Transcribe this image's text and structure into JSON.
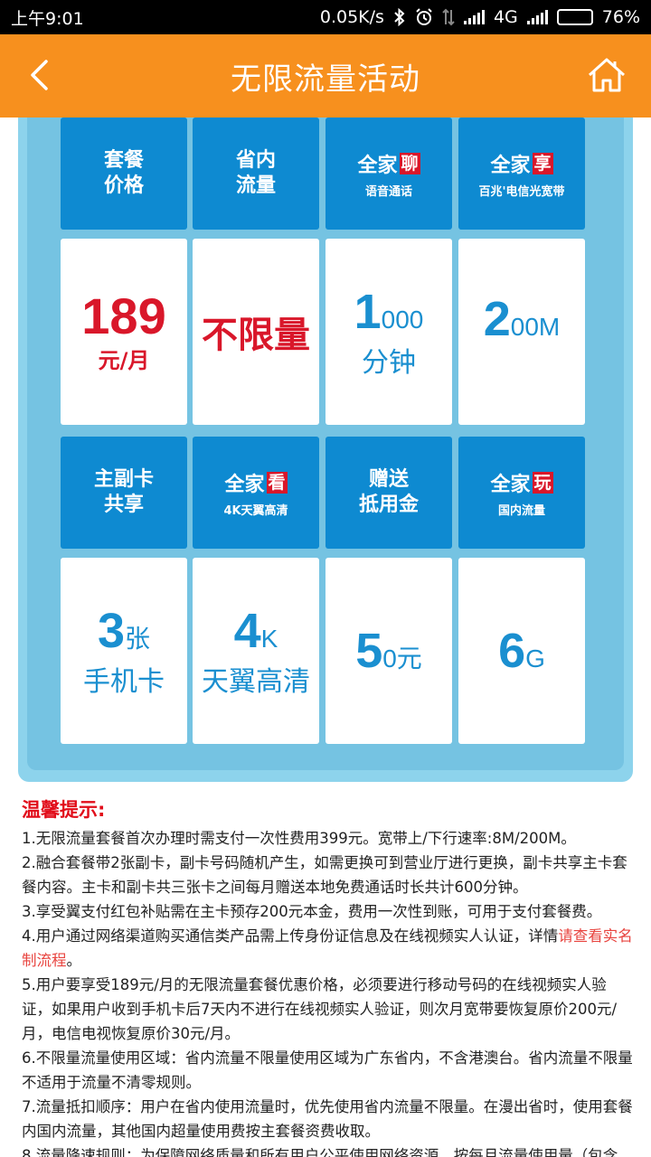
{
  "status_bar": {
    "time": "上午9:01",
    "speed": "0.05K/s",
    "network": "4G",
    "battery": "76%",
    "battery_level": 0.76,
    "icons": [
      "bluetooth-icon",
      "alarm-icon",
      "data-arrows-icon",
      "signal-icon",
      "signal-icon",
      "battery-icon"
    ]
  },
  "app_bar": {
    "title": "无限流量活动",
    "back_icon": "chevron-left-icon",
    "home_icon": "home-icon"
  },
  "banner": {
    "row1_heads": [
      {
        "line1": "套餐",
        "line2": "价格"
      },
      {
        "line1": "省内",
        "line2": "流量"
      },
      {
        "main": "全家",
        "tag": "聊",
        "sub": "语音通话"
      },
      {
        "main": "全家",
        "tag": "享",
        "sub": "百兆'电信光宽带"
      }
    ],
    "row1_values": {
      "price": "189",
      "price_unit": "元/月",
      "unlimited": "不限量",
      "minutes_big": "1",
      "minutes_rest": "000",
      "minutes_unit": "分钟",
      "bw_big": "2",
      "bw_rest": "00M"
    },
    "row2_heads": [
      {
        "line1": "主副卡",
        "line2": "共享"
      },
      {
        "main": "全家",
        "tag": "看",
        "sub": "4K天翼高清"
      },
      {
        "line1": "赠送",
        "line2": "抵用金"
      },
      {
        "main": "全家",
        "tag": "玩",
        "sub": "国内流量"
      }
    ],
    "row2_values": {
      "cards_big": "3",
      "cards_unit": "张",
      "cards_label": "手机卡",
      "tv_big": "4",
      "tv_unit": "K",
      "tv_label": "天翼高清",
      "voucher_big": "5",
      "voucher_rest": "0元",
      "data_big": "6",
      "data_unit": "G"
    }
  },
  "notes": {
    "heading": "温馨提示:",
    "item1": "1.无限流量套餐首次办理时需支付一次性费用399元。宽带上/下行速率:8M/200M。",
    "item2": "2.融合套餐带2张副卡，副卡号码随机产生，如需更换可到营业厅进行更换，副卡共享主卡套餐内容。主卡和副卡共三张卡之间每月赠送本地免费通话时长共计600分钟。",
    "item3": "3.享受翼支付红包补贴需在主卡预存200元本金，费用一次性到账，可用于支付套餐费。",
    "item4_prefix": "4.用户通过网络渠道购买通信类产品需上传身份证信息及在线视频实人认证，详情",
    "item4_link": "请查看实名制流程",
    "item4_suffix": "。",
    "item5": "5.用户要享受189元/月的无限流量套餐优惠价格，必须要进行移动号码的在线视频实人验证，如果用户收到手机卡后7天内不进行在线视频实人验证，则次月宽带要恢复原价200元/月，电信电视恢复原价30元/月。",
    "item6": "6.不限量流量使用区域：省内流量不限量使用区域为广东省内，不含港澳台。省内流量不限量不适用于流量不清零规则。",
    "item7": "7.流量抵扣顺序：用户在省内使用流量时，优先使用省内流量不限量。在漫出省时，使用套餐内国内流量，其他国内超量使用费按主套餐资费收取。",
    "item8": "8.流量降速规则：为保障网络质量和所有用户公平使用网络资源，按每月流量使用量（包含"
  }
}
